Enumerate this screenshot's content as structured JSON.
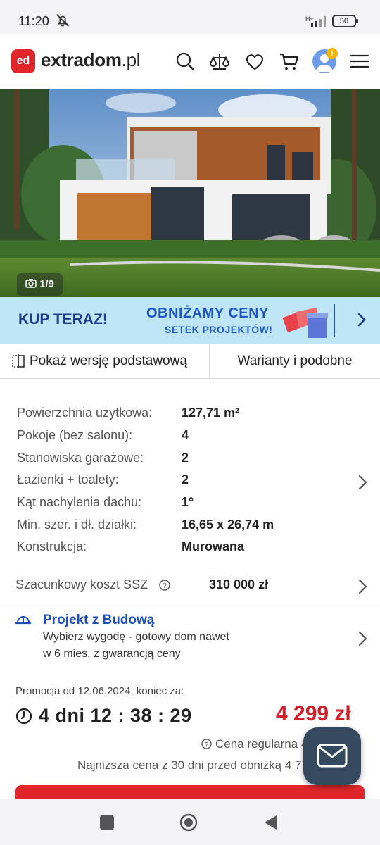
{
  "status_bar": {
    "time": "11:20",
    "network": "H+",
    "battery": "50",
    "icons": [
      "bell-off-icon",
      "signal-icon",
      "battery-icon"
    ]
  },
  "header": {
    "logo_text": "ed",
    "brand_name": "extradom",
    "brand_tld": ".pl",
    "icons": [
      "search-icon",
      "compare-scale-icon",
      "heart-icon",
      "cart-icon",
      "user-avatar-icon",
      "menu-icon"
    ],
    "notification_badge": "!"
  },
  "hero": {
    "photo_counter": "1/9"
  },
  "banner": {
    "cta": "KUP TERAZ!",
    "headline": "OBNIŻAMY CENY",
    "subline": "SETEK PROJEKTÓW!"
  },
  "tabs": {
    "basic_version": "Pokaż wersję podstawową",
    "variants": "Warianty i podobne"
  },
  "specs": [
    {
      "label": "Powierzchnia użytkowa:",
      "value": "127,71 m²"
    },
    {
      "label": "Pokoje (bez salonu):",
      "value": "4"
    },
    {
      "label": "Stanowiska garażowe:",
      "value": "2"
    },
    {
      "label": "Łazienki + toalety:",
      "value": "2"
    },
    {
      "label": "Kąt nachylenia dachu:",
      "value": "1°"
    },
    {
      "label": "Min. szer. i dł. działki:",
      "value": "16,65 x 26,74 m"
    },
    {
      "label": "Konstrukcja:",
      "value": "Murowana"
    }
  ],
  "cost": {
    "label": "Szacunkowy koszt SSZ",
    "value": "310 000 zł"
  },
  "budowa": {
    "title": "Projekt z Budową",
    "desc_line1": "Wybierz wygodę - gotowy dom nawet",
    "desc_line2": "w 6 mies. z gwarancją ceny"
  },
  "promo": {
    "from": "Promocja od 12.06.2024, koniec za:",
    "countdown": "4 dni 12 : 38 : 29",
    "price": "4 299 zł",
    "regular_price": "Cena regularna 4 776 zł",
    "lowest_price": "Najniższa cena z 30 dni przed obniżką 4 776 zł"
  },
  "colors": {
    "brand_red": "#e0262b",
    "banner_bg": "#bfe6f7",
    "link_blue": "#1e4fb4",
    "fab_bg": "#34495e"
  }
}
